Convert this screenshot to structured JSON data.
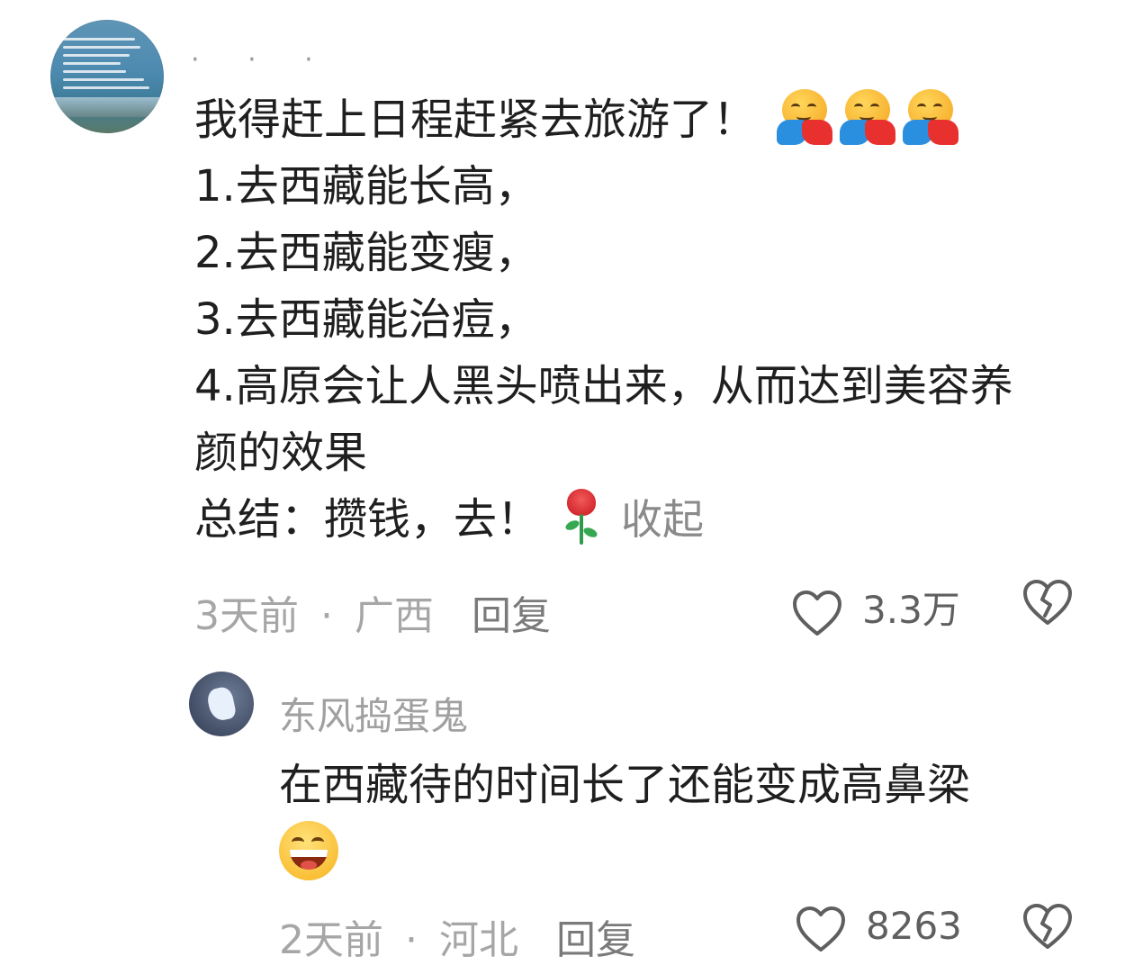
{
  "comment_main": {
    "username_placeholder": "· · ·",
    "lines": [
      "我得赶上日程赶紧去旅游了！",
      "1.去西藏能长高，",
      "2.去西藏能变瘦，",
      "3.去西藏能治痘，",
      "4.高原会让人黑头喷出来，从而达到美容养",
      "颜的效果",
      "总结：攒钱，去！"
    ],
    "title_emoji": "hugging-face-emoji",
    "summary_emoji": "rose-emoji",
    "collapse_label": "收起",
    "time": "3天前",
    "location": "广西",
    "separator": "·",
    "reply_label": "回复",
    "like_count": "3.3万"
  },
  "comment_reply": {
    "username": "东风捣蛋鬼",
    "text": "在西藏待的时间长了还能变成高鼻梁",
    "emoji": "grinning-face-emoji",
    "time": "2天前",
    "location": "河北",
    "separator": "·",
    "reply_label": "回复",
    "like_count": "8263"
  }
}
